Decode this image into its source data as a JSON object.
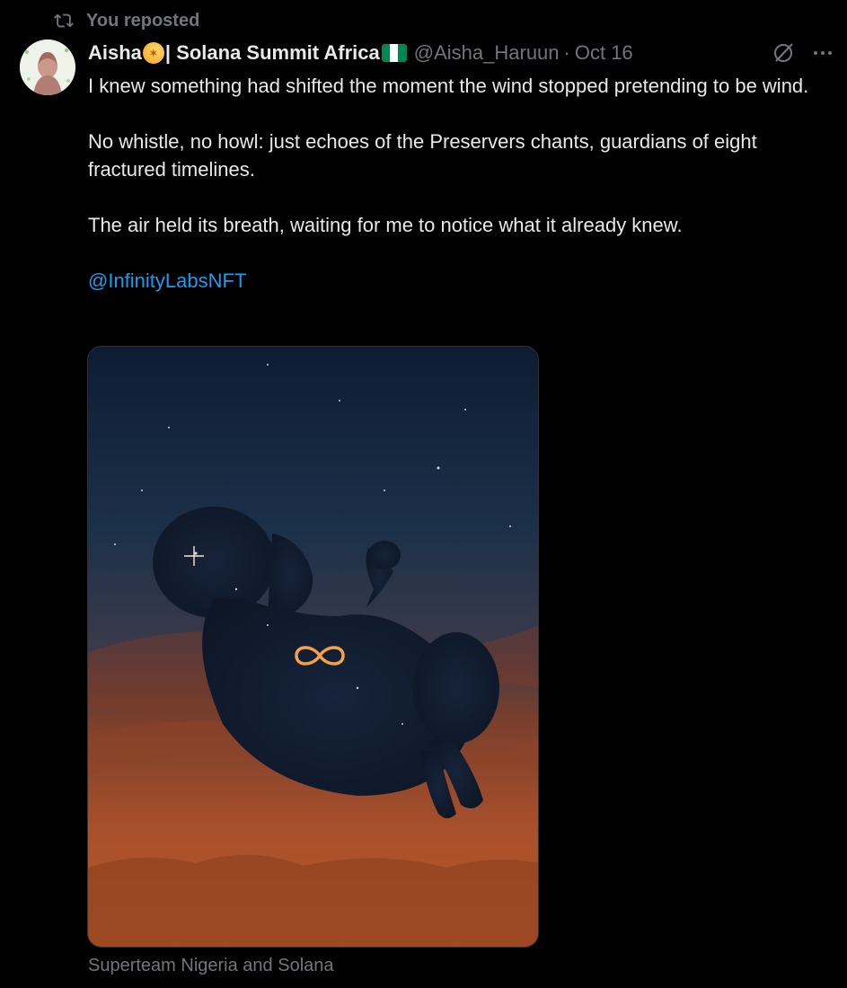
{
  "repost": {
    "label": "You reposted",
    "icon": "repost-icon"
  },
  "author": {
    "name_prefix": "Aisha",
    "name_suffix": "| Solana Summit Africa",
    "name_emoji": "dizzy-star",
    "flag": "nigeria-flag",
    "handle": "@Aisha_Haruun",
    "separator": "·",
    "date": "Oct 16"
  },
  "actions": {
    "grok_icon": "slash-circle-icon",
    "more_icon": "more-dots-icon",
    "more_label": "···"
  },
  "tweet": {
    "paragraphs": [
      "I knew something had shifted the moment the wind stopped pretending to be wind.",
      "No whistle, no howl: just echoes of the Preservers chants, guardians of eight fractured timelines.",
      "The air held its breath, waiting for me to notice what it already knew."
    ],
    "mention": "@InfinityLabsNFT"
  },
  "media": {
    "alt": "",
    "caption": "Superteam Nigeria and Solana"
  },
  "colors": {
    "background": "#000000",
    "text": "#e7e9ea",
    "muted": "#71767b",
    "link": "#1d9bf0",
    "flag_green": "#008751",
    "flag_white": "#ffffff"
  }
}
